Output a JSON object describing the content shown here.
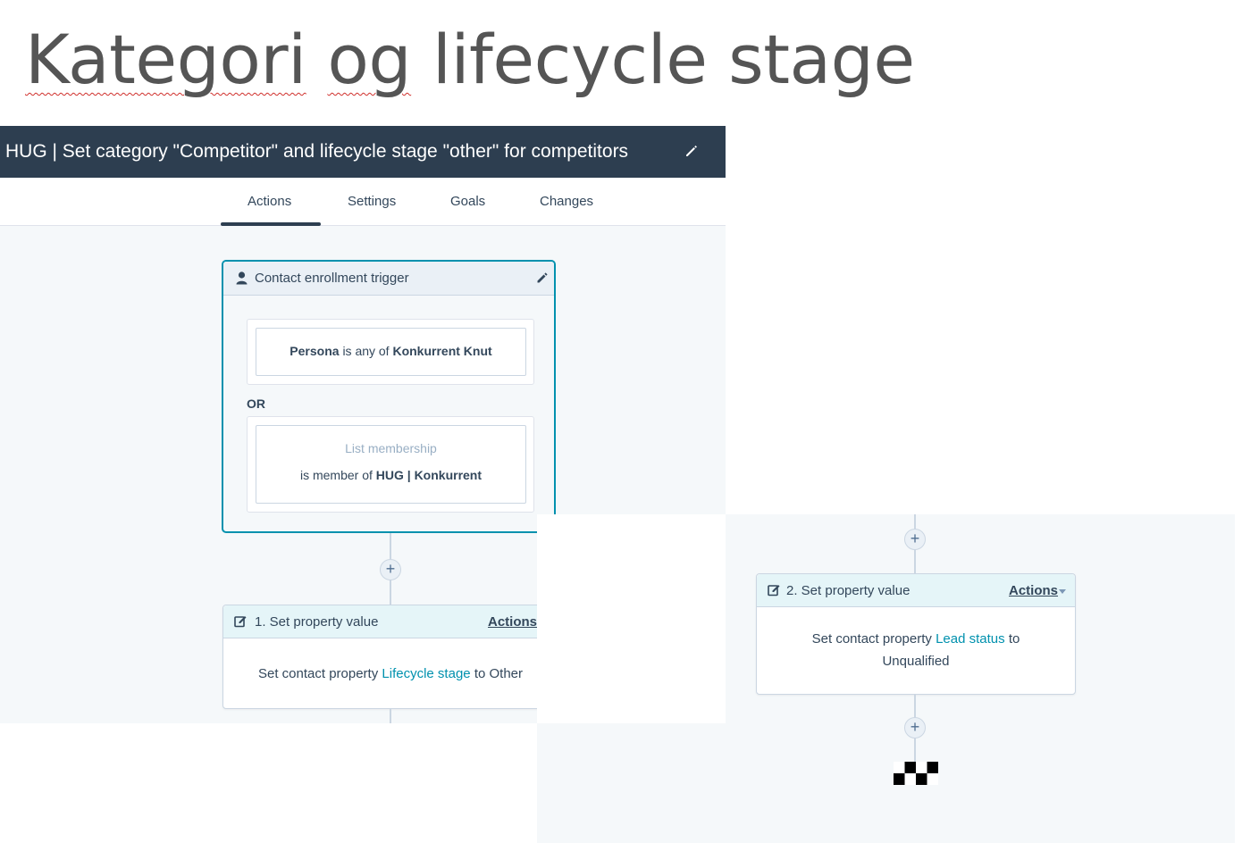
{
  "slide": {
    "title_word1": "Kategori",
    "title_word2": "og",
    "title_rest": "lifecycle stage"
  },
  "workflow": {
    "title": "HUG | Set category \"Competitor\" and lifecycle stage \"other\" for competitors",
    "tabs": [
      "Actions",
      "Settings",
      "Goals",
      "Changes"
    ],
    "active_tab": "Actions"
  },
  "trigger": {
    "header": "Contact enrollment trigger",
    "filter1": {
      "property": "Persona",
      "operator": "is any of",
      "value": "Konkurrent Knut"
    },
    "or_label": "OR",
    "filter2": {
      "type": "List membership",
      "operator": "is member of",
      "value": "HUG | Konkurrent"
    }
  },
  "actions": [
    {
      "title": "1. Set property value",
      "menu_label": "Actions",
      "prefix": "Set contact property",
      "property": "Lifecycle stage",
      "connector": "to",
      "value": "Other"
    },
    {
      "title": "2. Set property value",
      "menu_label": "Actions",
      "prefix": "Set contact property",
      "property": "Lead status",
      "connector": "to",
      "value": "Unqualified"
    }
  ],
  "icons": {
    "header_edit": "pencil-icon",
    "trigger": "person-icon",
    "trigger_edit": "pencil-icon",
    "action": "edit-square-icon",
    "add": "plus-icon",
    "end": "finish-flag-icon"
  },
  "colors": {
    "header_bg": "#2d3e50",
    "accent": "#0091ae",
    "canvas_bg": "#f5f8fa",
    "text": "#33475b"
  }
}
